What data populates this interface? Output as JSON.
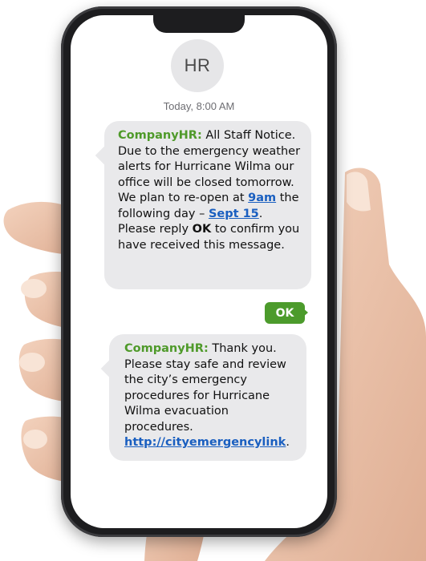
{
  "contact": {
    "avatar_initials": "HR"
  },
  "thread": {
    "timestamp": "Today, 8:00 AM",
    "message1": {
      "sender": "CompanyHR:",
      "text_a": " All Staff Notice. Due to the emergency weather alerts for Hurricane Wilma our office will be closed tomorrow. We plan to re-open at ",
      "time_link": "9am",
      "text_b": " the following day – ",
      "date_link": "Sept 15",
      "text_c": ". Please reply ",
      "keyword": "OK",
      "text_d": " to confirm you have received this message."
    },
    "reply": {
      "text": "OK"
    },
    "message2": {
      "sender": "CompanyHR:",
      "text_a": " Thank you. Please stay safe and review the city’s emergency procedures for Hurricane Wilma evacuation procedures. ",
      "link": "http://cityemergencylink",
      "text_b": "."
    }
  },
  "colors": {
    "sender": "#4f9a2a",
    "link": "#1a5fc0",
    "incoming_bubble": "#e9e9eb",
    "outgoing_bubble": "#4c9b2c"
  }
}
